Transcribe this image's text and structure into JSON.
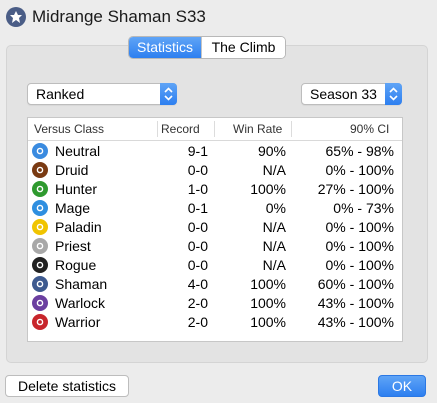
{
  "window": {
    "title": "Midrange Shaman S33",
    "icon": "shaman-class-icon"
  },
  "tabs": [
    {
      "label": "Statistics",
      "active": true
    },
    {
      "label": "The Climb",
      "active": false
    }
  ],
  "filters": {
    "mode": "Ranked",
    "season": "Season 33"
  },
  "table": {
    "headers": [
      "Versus Class",
      "Record",
      "Win Rate",
      "90% CI"
    ],
    "rows": [
      {
        "class": "Neutral",
        "icon": "neutral-icon",
        "color": "#3a8be0",
        "record": "9-1",
        "win_rate": "90%",
        "ci": "65% -  98%"
      },
      {
        "class": "Druid",
        "icon": "druid-icon",
        "color": "#7a3a12",
        "record": "0-0",
        "win_rate": "N/A",
        "ci": "0% - 100%"
      },
      {
        "class": "Hunter",
        "icon": "hunter-icon",
        "color": "#2f9a2f",
        "record": "1-0",
        "win_rate": "100%",
        "ci": "27% - 100%"
      },
      {
        "class": "Mage",
        "icon": "mage-icon",
        "color": "#2f8fe0",
        "record": "0-1",
        "win_rate": "0%",
        "ci": "0% -  73%"
      },
      {
        "class": "Paladin",
        "icon": "paladin-icon",
        "color": "#f0c400",
        "record": "0-0",
        "win_rate": "N/A",
        "ci": "0% - 100%"
      },
      {
        "class": "Priest",
        "icon": "priest-icon",
        "color": "#a8a8a8",
        "record": "0-0",
        "win_rate": "N/A",
        "ci": "0% - 100%"
      },
      {
        "class": "Rogue",
        "icon": "rogue-icon",
        "color": "#222222",
        "record": "0-0",
        "win_rate": "N/A",
        "ci": "0% - 100%"
      },
      {
        "class": "Shaman",
        "icon": "shaman-icon",
        "color": "#3e5a8f",
        "record": "4-0",
        "win_rate": "100%",
        "ci": "60% - 100%"
      },
      {
        "class": "Warlock",
        "icon": "warlock-icon",
        "color": "#6b3fa0",
        "record": "2-0",
        "win_rate": "100%",
        "ci": "43% - 100%"
      },
      {
        "class": "Warrior",
        "icon": "warrior-icon",
        "color": "#c8262c",
        "record": "2-0",
        "win_rate": "100%",
        "ci": "43% - 100%"
      }
    ]
  },
  "buttons": {
    "delete": "Delete statistics",
    "ok": "OK"
  }
}
